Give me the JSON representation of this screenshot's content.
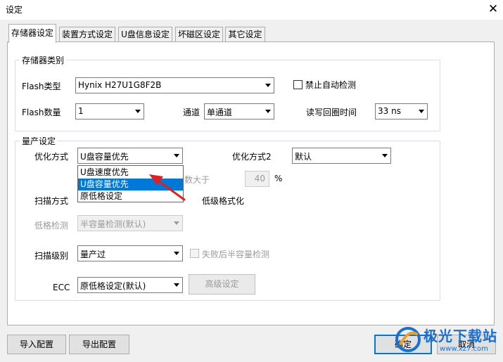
{
  "window": {
    "title": "设定"
  },
  "tabs": [
    {
      "label": "存储器设定"
    },
    {
      "label": "装置方式设定"
    },
    {
      "label": "U盘信息设定"
    },
    {
      "label": "坏磁区设定"
    },
    {
      "label": "其它设定"
    }
  ],
  "storage_type": {
    "group_title": "存储器类别",
    "flash_type_label": "Flash类型",
    "flash_type_value": "Hynix H27U1G8F2B",
    "disable_auto_detect_label": "禁止自动检测",
    "disable_auto_detect_checked": false,
    "flash_count_label": "Flash数量",
    "flash_count_value": "1",
    "channel_label": "通道",
    "channel_value": "单通道",
    "rw_cycle_label": "读写回圈时间",
    "rw_cycle_value": "33 ns"
  },
  "mass_production": {
    "group_title": "量产设定",
    "optimize_label": "优化方式",
    "optimize_value": "U盘容量优先",
    "optimize_options": [
      "U盘速度优先",
      "U盘容量优先",
      "原低格设定"
    ],
    "optimize_selected_index": 1,
    "optimize2_label": "优化方式2",
    "optimize2_value": "默认",
    "count_greater_label": "数大于",
    "count_value": "40",
    "percent_label": "%",
    "scan_mode_label": "扫描方式",
    "low_format_label": "低级格式化",
    "low_format_check_label": "低格检测",
    "low_format_check_value": "半容量检测(默认)",
    "scan_level_label": "扫描级别",
    "scan_level_value": "量产过",
    "fail_half_check_label": "失败后半容量检测",
    "ecc_label": "ECC",
    "ecc_value": "原低格设定(默认)",
    "advanced_button": "高级设定"
  },
  "footer": {
    "import_button": "导入配置",
    "export_button": "导出配置",
    "ok_button": "确定",
    "cancel_button": "取消"
  },
  "watermark": {
    "text": "极光下载站",
    "url": "www.xz7.com"
  },
  "colors": {
    "selection": "#0078d7",
    "arrow": "#e02020",
    "watermark": "#1a6fd0"
  }
}
